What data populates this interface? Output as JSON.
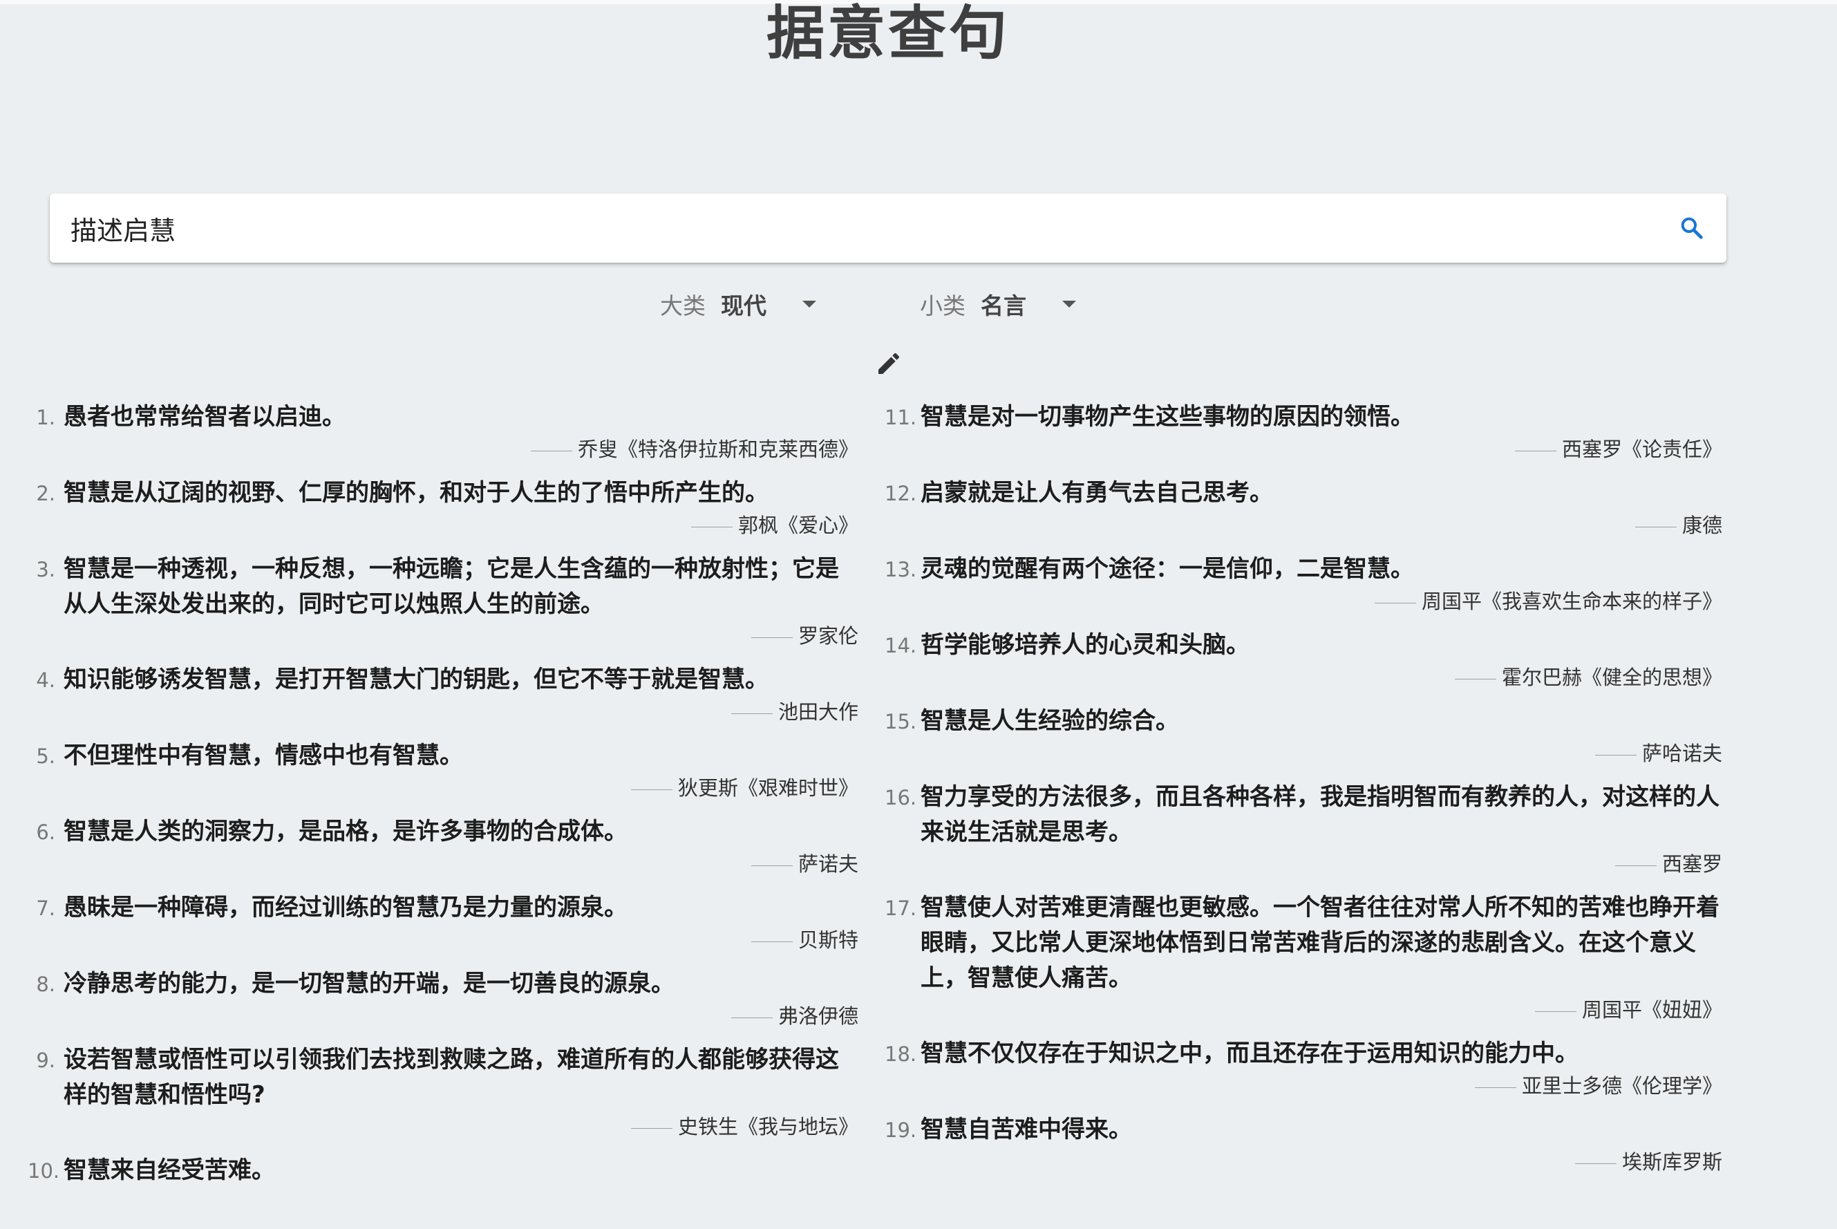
{
  "page": {
    "title": "据意查句"
  },
  "search": {
    "value": "描述启慧",
    "icon": "search-icon",
    "icon_color": "#1976d2"
  },
  "filters": {
    "category": {
      "label": "大类",
      "value": "现代"
    },
    "subcategory": {
      "label": "小类",
      "value": "名言"
    }
  },
  "edit": {
    "icon": "edit-icon"
  },
  "quotes_left": [
    {
      "num": "1.",
      "text": "愚者也常常给智者以启迪。",
      "source": "乔叟《特洛伊拉斯和克莱西德》"
    },
    {
      "num": "2.",
      "text": "智慧是从辽阔的视野、仁厚的胸怀，和对于人生的了悟中所产生的。",
      "source": "郭枫《爱心》"
    },
    {
      "num": "3.",
      "text": "智慧是一种透视，一种反想，一种远瞻；它是人生含蕴的一种放射性；它是从人生深处发出来的，同时它可以烛照人生的前途。",
      "source": "罗家伦"
    },
    {
      "num": "4.",
      "text": "知识能够诱发智慧，是打开智慧大门的钥匙，但它不等于就是智慧。",
      "source": "池田大作"
    },
    {
      "num": "5.",
      "text": "不但理性中有智慧，情感中也有智慧。",
      "source": "狄更斯《艰难时世》"
    },
    {
      "num": "6.",
      "text": "智慧是人类的洞察力，是品格，是许多事物的合成体。",
      "source": "萨诺夫"
    },
    {
      "num": "7.",
      "text": "愚昧是一种障碍，而经过训练的智慧乃是力量的源泉。",
      "source": "贝斯特"
    },
    {
      "num": "8.",
      "text": "冷静思考的能力，是一切智慧的开端，是一切善良的源泉。",
      "source": "弗洛伊德"
    },
    {
      "num": "9.",
      "text": "设若智慧或悟性可以引领我们去找到救赎之路，难道所有的人都能够获得这样的智慧和悟性吗?",
      "source": "史铁生《我与地坛》"
    },
    {
      "num": "10.",
      "text": "智慧来自经受苦难。",
      "source": ""
    }
  ],
  "quotes_right": [
    {
      "num": "11.",
      "text": "智慧是对一切事物产生这些事物的原因的领悟。",
      "source": "西塞罗《论责任》"
    },
    {
      "num": "12.",
      "text": "启蒙就是让人有勇气去自己思考。",
      "source": "康德"
    },
    {
      "num": "13.",
      "text": "灵魂的觉醒有两个途径：一是信仰，二是智慧。",
      "source": "周国平《我喜欢生命本来的样子》"
    },
    {
      "num": "14.",
      "text": "哲学能够培养人的心灵和头脑。",
      "source": "霍尔巴赫《健全的思想》"
    },
    {
      "num": "15.",
      "text": "智慧是人生经验的综合。",
      "source": "萨哈诺夫"
    },
    {
      "num": "16.",
      "text": "智力享受的方法很多，而且各种各样，我是指明智而有教养的人，对这样的人来说生活就是思考。",
      "source": "西塞罗"
    },
    {
      "num": "17.",
      "text": "智慧使人对苦难更清醒也更敏感。一个智者往往对常人所不知的苦难也睁开着眼睛，又比常人更深地体悟到日常苦难背后的深遂的悲剧含义。在这个意义上，智慧使人痛苦。",
      "source": "周国平《妞妞》"
    },
    {
      "num": "18.",
      "text": "智慧不仅仅存在于知识之中，而且还存在于运用知识的能力中。",
      "source": "亚里士多德《伦理学》"
    },
    {
      "num": "19.",
      "text": "智慧自苦难中得来。",
      "source": "埃斯库罗斯"
    }
  ]
}
